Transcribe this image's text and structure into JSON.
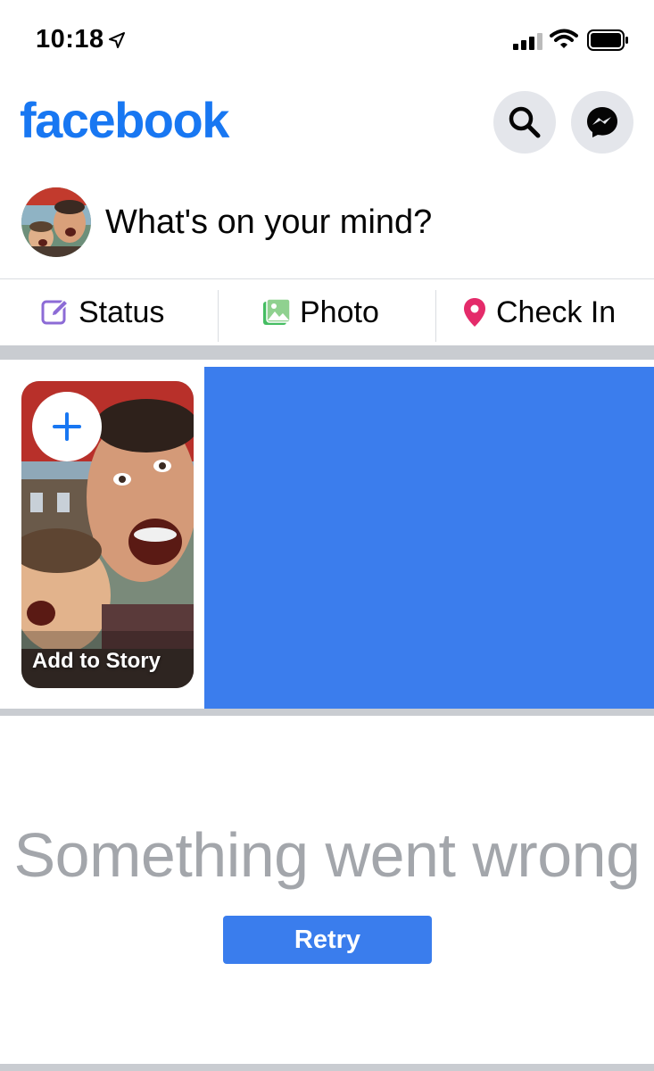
{
  "status_bar": {
    "time": "10:18",
    "icons": [
      "location-arrow-icon",
      "signal-bars-icon",
      "wifi-icon",
      "battery-icon"
    ]
  },
  "header": {
    "logo": "facebook",
    "logo_color": "#1877f2",
    "buttons": [
      "search-icon",
      "messenger-icon"
    ]
  },
  "composer": {
    "prompt": "What's on your mind?"
  },
  "actions": [
    {
      "label": "Status",
      "icon": "edit-icon",
      "color": "#8c6bd6"
    },
    {
      "label": "Photo",
      "icon": "photo-icon",
      "color": "#45bd62"
    },
    {
      "label": "Check In",
      "icon": "location-pin-icon",
      "color": "#e42b6a"
    }
  ],
  "stories": {
    "add_label": "Add to Story",
    "add_icon": "plus-icon"
  },
  "error": {
    "message": "Something went wrong",
    "retry_label": "Retry"
  },
  "colors": {
    "accent": "#3a7ded",
    "separator": "#c9ccd1",
    "error_text": "#a3a6ab"
  }
}
